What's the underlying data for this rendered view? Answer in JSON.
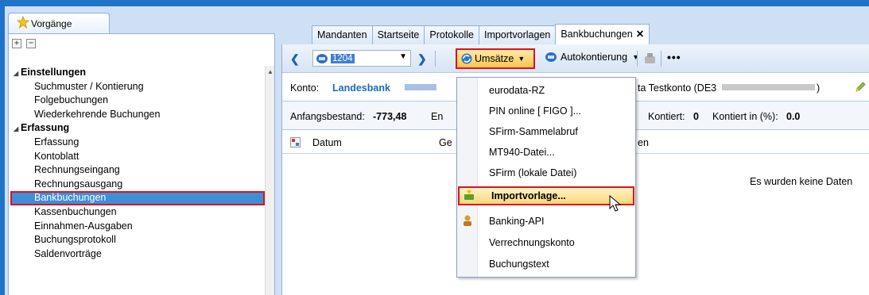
{
  "left_panel": {
    "tab_label": "Vorgänge",
    "expand_all": "+",
    "collapse_all": "−",
    "groups": [
      {
        "label": "Einstellungen",
        "items": [
          "Suchmuster / Kontierung",
          "Folgebuchungen",
          "Wiederkehrende Buchungen"
        ]
      },
      {
        "label": "Erfassung",
        "items": [
          "Erfassung",
          "Kontoblatt",
          "Rechnungseingang",
          "Rechnungsausgang",
          "Bankbuchungen",
          "Kassenbuchungen",
          "Einnahmen-Ausgaben",
          "Buchungsprotokoll",
          "Saldenvorträge"
        ]
      }
    ]
  },
  "tabs": [
    "Mandanten",
    "Startseite",
    "Protokolle",
    "Importvorlagen",
    "Bankbuchungen"
  ],
  "active_tab_close": "✕",
  "toolbar": {
    "konto_value": "1204",
    "umsaetze_label": "Umsätze",
    "autokontierung_label": "Autokontierung",
    "more": "•••"
  },
  "konto_bar": {
    "label": "Konto:",
    "bank_name": "Landesbank",
    "right_text": "ta Testkonto (DE3",
    "right_tail": ")"
  },
  "stats": {
    "anfangsbestand_label": "Anfangsbestand:",
    "anfangsbestand_value": "-773,48",
    "en": "En",
    "kontiert_label": "Kontiert:",
    "kontiert_value": "0",
    "kontiert_pct_label": "Kontiert in (%):",
    "kontiert_pct_value": "0.0"
  },
  "grid": {
    "col_datum": "Datum",
    "col_ge": "Ge",
    "col_en": "en",
    "empty_message": "Es wurden keine Daten"
  },
  "menu": {
    "items": [
      "eurodata-RZ",
      "PIN online [ FIGO ]...",
      "SFirm-Sammelabruf",
      "MT940-Datei...",
      "SFirm (lokale Datei)",
      "Importvorlage...",
      "Banking-API",
      "Verrechnungskonto",
      "Buchungstext"
    ],
    "highlighted_index": 5
  },
  "colors": {
    "frame": "#1f74c8",
    "selection": "#3e8ed8",
    "highlight_border": "#e0121b",
    "bank_name": "#1c6ab8"
  }
}
